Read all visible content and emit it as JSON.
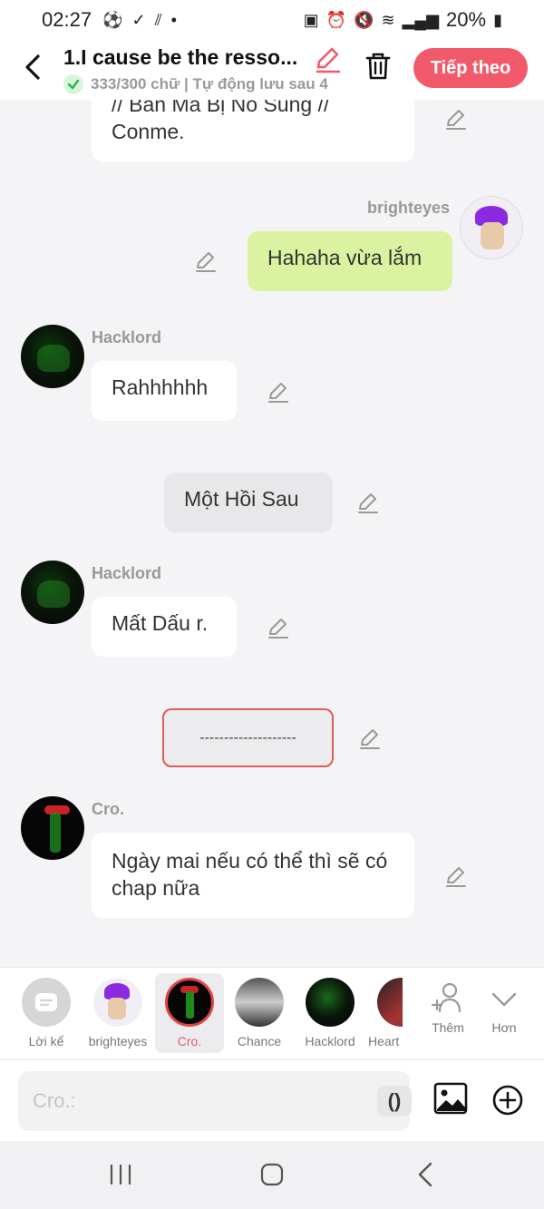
{
  "status_bar": {
    "time": "02:27",
    "battery": "20%"
  },
  "header": {
    "title": "1.I cause be the resso...",
    "subtitle": "333/300 chữ | Tự động lưu sau 4",
    "next_label": "Tiếp theo"
  },
  "messages": {
    "m1": {
      "text_line1": "// Bản Mã Bị Nổ Súng //",
      "text_line2": "Conme."
    },
    "m2": {
      "author": "brighteyes",
      "text": "Hahaha vừa lắm"
    },
    "m3": {
      "author": "Hacklord",
      "text": "Rahhhhhh"
    },
    "m4": {
      "text": "Một Hồi Sau"
    },
    "m5": {
      "author": "Hacklord",
      "text": "Mất Dấu r."
    },
    "m6": {
      "text": "--------------------"
    },
    "m7": {
      "author": "Cro.",
      "text": "Ngày mai nếu có thể thì sẽ có chap nữa"
    }
  },
  "characters": [
    {
      "label": "Lời kể"
    },
    {
      "label": "brighteyes"
    },
    {
      "label": "Cro."
    },
    {
      "label": "Chance"
    },
    {
      "label": "Hacklord"
    },
    {
      "label": "Heart"
    },
    {
      "label": "Thêm"
    },
    {
      "label": "Hơn"
    }
  ],
  "input": {
    "placeholder": "Cro.:",
    "paren_label": "()"
  },
  "colors": {
    "accent": "#f25a6b",
    "my_bubble": "#dbf3a0",
    "divider_border": "#e35a5a"
  }
}
